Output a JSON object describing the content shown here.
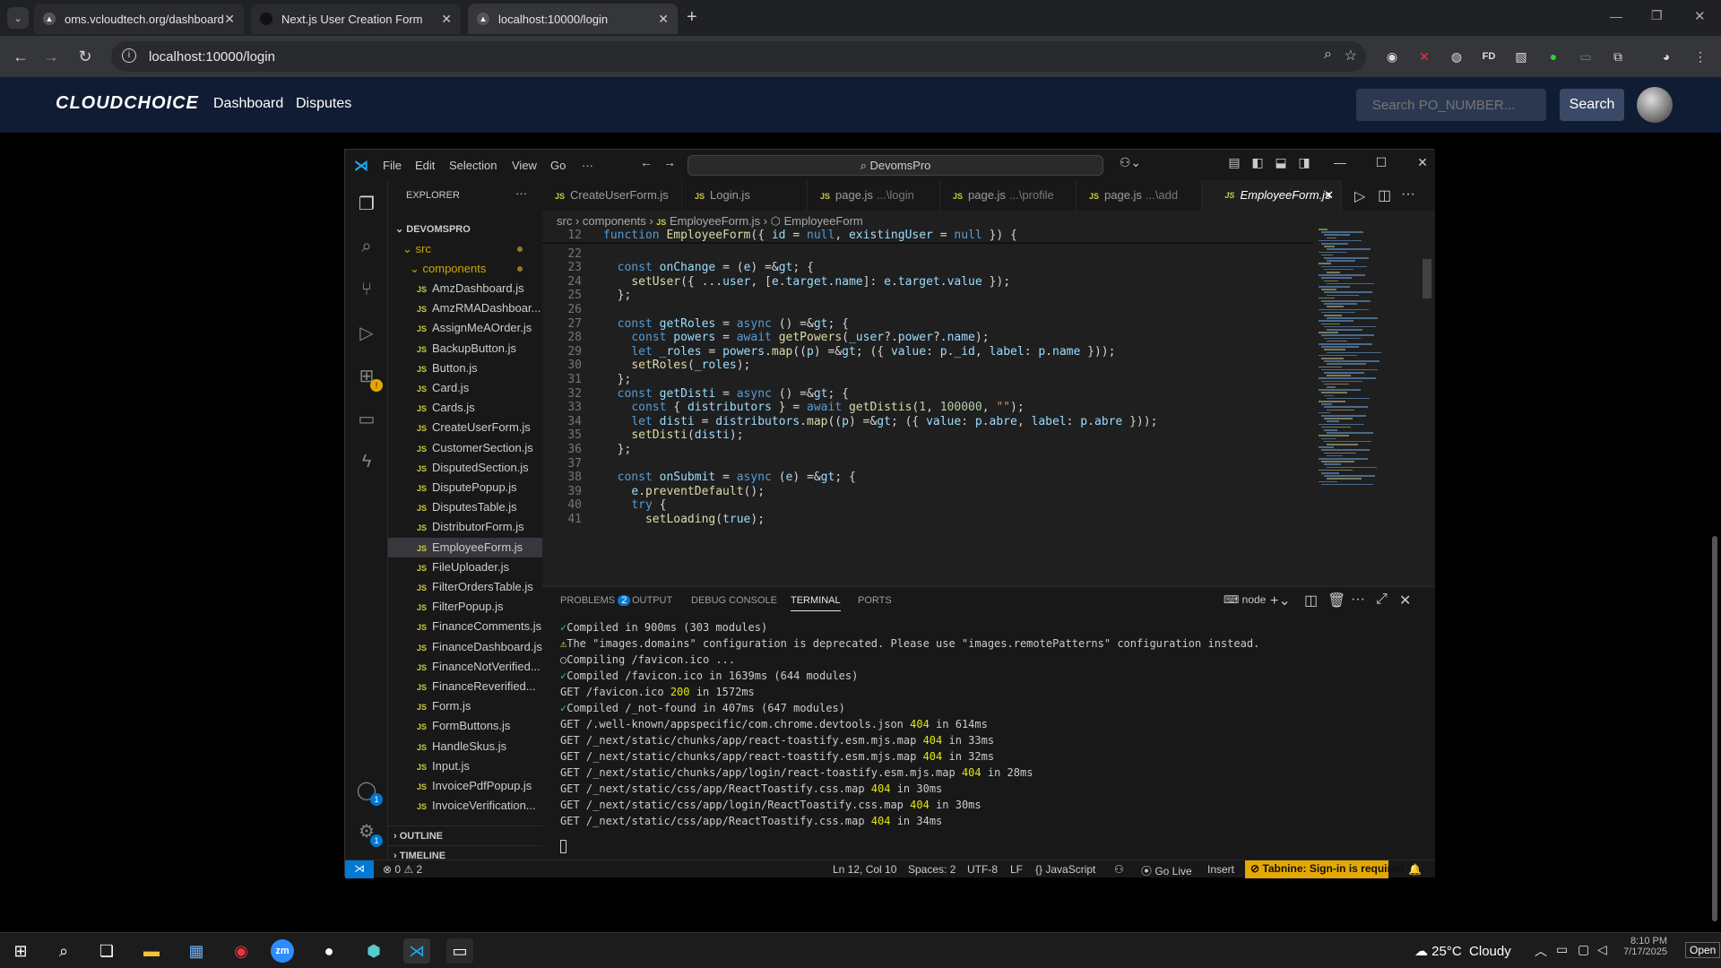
{
  "browser": {
    "tabs": [
      {
        "title": "oms.vcloudtech.org/dashboard"
      },
      {
        "title": "Next.js User Creation Form"
      },
      {
        "title": "localhost:10000/login"
      }
    ],
    "url": "localhost:10000/login",
    "new_tab": "+"
  },
  "site": {
    "logo": "CLOUDCHOICE",
    "nav": [
      "Dashboard",
      "Disputes"
    ],
    "search_placeholder": "Search PO_NUMBER...",
    "search_button": "Search"
  },
  "vscode": {
    "menu": [
      "File",
      "Edit",
      "Selection",
      "View",
      "Go",
      "···"
    ],
    "command_center": "DevomsPro",
    "explorer_title": "EXPLORER",
    "project": "DEVOMSPRO",
    "folders": [
      "src",
      "components"
    ],
    "files": [
      "AmzDashboard.js",
      "AmzRMADashboar...",
      "AssignMeAOrder.js",
      "BackupButton.js",
      "Button.js",
      "Card.js",
      "Cards.js",
      "CreateUserForm.js",
      "CustomerSection.js",
      "DisputedSection.js",
      "DisputePopup.js",
      "DisputesTable.js",
      "DistributorForm.js",
      "EmployeeForm.js",
      "FileUploader.js",
      "FilterOrdersTable.js",
      "FilterPopup.js",
      "FinanceComments.js",
      "FinanceDashboard.js",
      "FinanceNotVerified...",
      "FinanceReverified...",
      "Form.js",
      "FormButtons.js",
      "HandleSkus.js",
      "Input.js",
      "InvoicePdfPopup.js",
      "InvoiceVerification..."
    ],
    "selected_file": "EmployeeForm.js",
    "outline": "OUTLINE",
    "timeline": "TIMELINE",
    "editor_tabs": [
      {
        "label": "CreateUserForm.js",
        "hint": ""
      },
      {
        "label": "Login.js",
        "hint": ""
      },
      {
        "label": "page.js",
        "hint": "...\\login"
      },
      {
        "label": "page.js",
        "hint": "...\\profile"
      },
      {
        "label": "page.js",
        "hint": "...\\add"
      },
      {
        "label": "EmployeeForm.js",
        "hint": ""
      }
    ],
    "breadcrumb": [
      "src",
      "components",
      "EmployeeForm.js",
      "EmployeeForm"
    ],
    "code_lines": [
      {
        "n": "12",
        "t": "function EmployeeForm({ id = null, existingUser = null }) {"
      },
      {
        "n": "22",
        "t": ""
      },
      {
        "n": "23",
        "t": "  const onChange = (e) => {"
      },
      {
        "n": "24",
        "t": "    setUser({ ...user, [e.target.name]: e.target.value });"
      },
      {
        "n": "25",
        "t": "  };"
      },
      {
        "n": "26",
        "t": ""
      },
      {
        "n": "27",
        "t": "  const getRoles = async () => {"
      },
      {
        "n": "28",
        "t": "    const powers = await getPowers(_user?.power?.name);"
      },
      {
        "n": "29",
        "t": "    let _roles = powers.map((p) => ({ value: p._id, label: p.name }));"
      },
      {
        "n": "30",
        "t": "    setRoles(_roles);"
      },
      {
        "n": "31",
        "t": "  };"
      },
      {
        "n": "32",
        "t": "  const getDisti = async () => {"
      },
      {
        "n": "33",
        "t": "    const { distributors } = await getDistis(1, 100000, \"\");"
      },
      {
        "n": "34",
        "t": "    let disti = distributors.map((p) => ({ value: p.abre, label: p.abre }));"
      },
      {
        "n": "35",
        "t": "    setDisti(disti);"
      },
      {
        "n": "36",
        "t": "  };"
      },
      {
        "n": "37",
        "t": ""
      },
      {
        "n": "38",
        "t": "  const onSubmit = async (e) => {"
      },
      {
        "n": "39",
        "t": "    e.preventDefault();"
      },
      {
        "n": "40",
        "t": "    try {"
      },
      {
        "n": "41",
        "t": "      setLoading(true);"
      }
    ],
    "panel_tabs": [
      "PROBLEMS",
      "OUTPUT",
      "DEBUG CONSOLE",
      "TERMINAL",
      "PORTS"
    ],
    "problems_count": "2",
    "terminal_shell": "node",
    "terminal": [
      {
        "k": "ok",
        "mark": "✓",
        "t": "Compiled in 900ms (303 modules)"
      },
      {
        "k": "wn",
        "mark": "⚠",
        "t": "The \"images.domains\" configuration is deprecated. Please use \"images.remotePatterns\" configuration instead."
      },
      {
        "k": "plain",
        "mark": "○",
        "t": "Compiling /favicon.ico ..."
      },
      {
        "k": "ok",
        "mark": "✓",
        "t": "Compiled /favicon.ico in 1639ms (644 modules)"
      },
      {
        "k": "get",
        "pre": "GET /favicon.ico ",
        "code": "200",
        "post": " in 1572ms"
      },
      {
        "k": "ok",
        "mark": "✓",
        "t": "Compiled /_not-found in 407ms (647 modules)"
      },
      {
        "k": "get",
        "pre": "GET /.well-known/appspecific/com.chrome.devtools.json ",
        "code": "404",
        "post": " in 614ms"
      },
      {
        "k": "get",
        "pre": "GET /_next/static/chunks/app/react-toastify.esm.mjs.map ",
        "code": "404",
        "post": " in 33ms"
      },
      {
        "k": "get",
        "pre": "GET /_next/static/chunks/app/react-toastify.esm.mjs.map ",
        "code": "404",
        "post": " in 32ms"
      },
      {
        "k": "get",
        "pre": "GET /_next/static/chunks/app/login/react-toastify.esm.mjs.map ",
        "code": "404",
        "post": " in 28ms"
      },
      {
        "k": "get",
        "pre": "GET /_next/static/css/app/ReactToastify.css.map ",
        "code": "404",
        "post": " in 30ms"
      },
      {
        "k": "get",
        "pre": "GET /_next/static/css/app/login/ReactToastify.css.map ",
        "code": "404",
        "post": " in 30ms"
      },
      {
        "k": "get",
        "pre": "GET /_next/static/css/app/ReactToastify.css.map ",
        "code": "404",
        "post": " in 34ms"
      }
    ],
    "status": {
      "errors": "0",
      "warnings": "2",
      "position": "Ln 12, Col 10",
      "spaces": "Spaces: 2",
      "encoding": "UTF-8",
      "eol": "LF",
      "language": "JavaScript",
      "golive": "Go Live",
      "mode": "Insert",
      "tabnine": "Tabnine: Sign-in is required"
    }
  },
  "taskbar": {
    "weather": "25°C  Cloudy",
    "time": "8:10 PM",
    "date": "7/17/2025",
    "open": "Open"
  },
  "colors": {
    "accent": "#0078d4",
    "tabnine": "#e5a800",
    "site_nav": "#101c33"
  }
}
